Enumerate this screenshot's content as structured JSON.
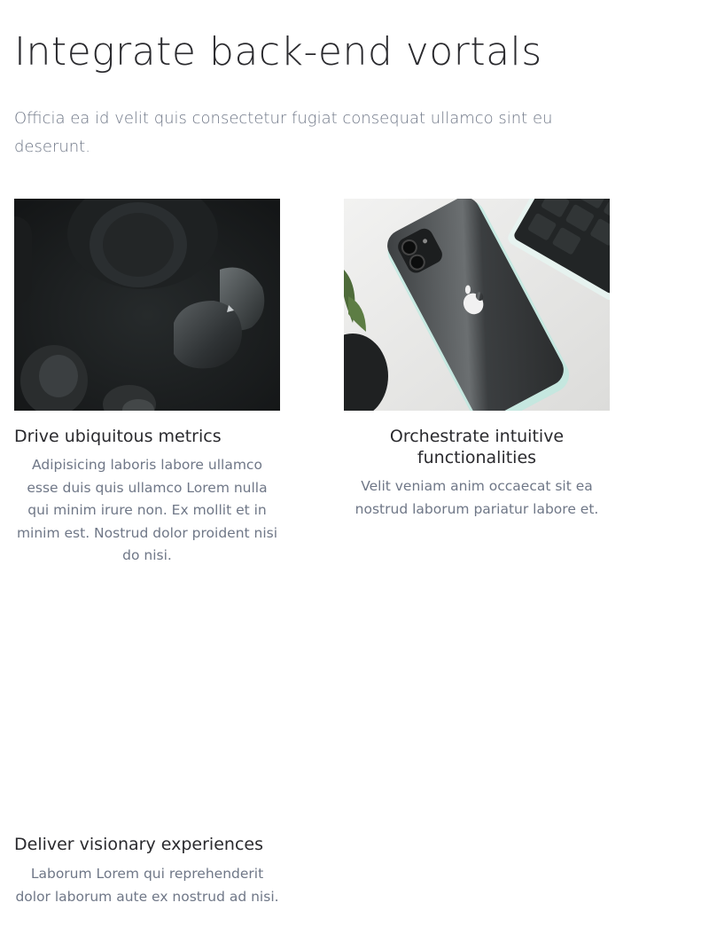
{
  "hero": {
    "title": "Integrate back-end vortals",
    "subtitle": "Officia ea id velit quis consectetur fugiat consequat ullamco sint eu deserunt."
  },
  "cards": [
    {
      "title": "Drive ubiquitous metrics",
      "description": "Adipisicing laboris labore ullamco esse duis quis ullamco Lorem nulla qui minim irure non. Ex mollit et in minim est. Nostrud dolor proident nisi do nisi.",
      "image": "dark-earbuds-photo"
    },
    {
      "title": "Orchestrate intuitive functionalities",
      "description": "Velit veniam anim occaecat sit ea nostrud laborum pariatur labore et.",
      "image": "black-iphone-keyboard-photo"
    },
    {
      "title": "Deliver visionary experiences",
      "description": "Laborum Lorem qui reprehenderit dolor laborum aute ex nostrud ad nisi.",
      "image": ""
    }
  ],
  "colors": {
    "heading": "#2a2a2e",
    "body_text": "#6f7787",
    "background": "#ffffff"
  }
}
